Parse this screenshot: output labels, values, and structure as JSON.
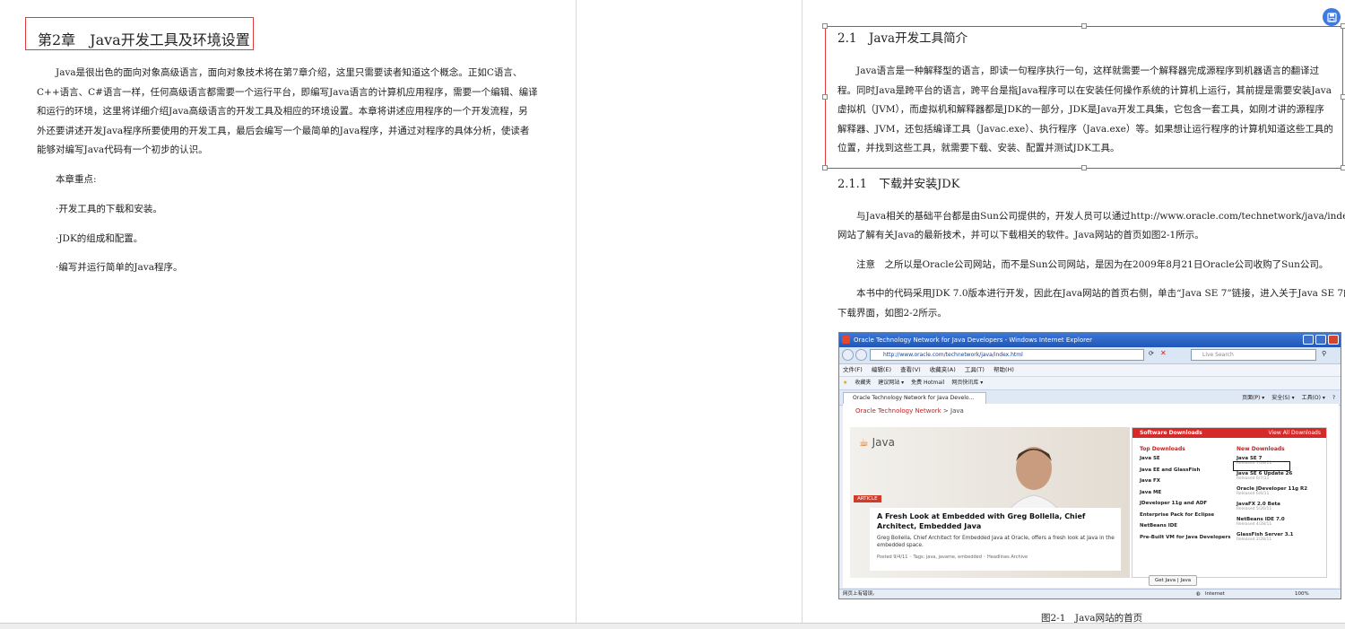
{
  "left": {
    "chapter_title": "第2章　Java开发工具及环境设置",
    "intro_lines": [
      "Java是很出色的面向对象高级语言，面向对象技术将在第7章介绍，这里只需要读者知道这个概念。正如C语言、",
      "C++语言、C#语言一样，任何高级语言都需要一个运行平台，即编写Java语言的计算机应用程序，需要一个编辑、编译",
      "和运行的环境，这里将详细介绍Java高级语言的开发工具及相应的环境设置。本章将讲述应用程序的一个开发流程，另",
      "外还要讲述开发Java程序所要使用的开发工具，最后会编写一个最简单的Java程序，并通过对程序的具体分析，使读者",
      "能够对编写Java代码有一个初步的认识。"
    ],
    "focus_heading": "本章重点:",
    "focus_items": [
      "·开发工具的下载和安装。",
      "·JDK的组成和配置。",
      "·编写并运行简单的Java程序。"
    ]
  },
  "right": {
    "section_title": "2.1　Java开发工具简介",
    "section_lines": [
      "Java语言是一种解释型的语言，即读一句程序执行一句，这样就需要一个解释器完成源程序到机器语言的翻译过",
      "程。同时Java是跨平台的语言，跨平台是指Java程序可以在安装任何操作系统的计算机上运行，其前提是需要安装Java",
      "虚拟机（JVM），而虚拟机和解释器都是JDK的一部分，JDK是Java开发工具集，它包含一套工具，如刚才讲的源程序",
      "解释器、JVM，还包括编译工具（Javac.exe）、执行程序（Java.exe）等。如果想让运行程序的计算机知道这些工具的",
      "位置，并找到这些工具，就需要下载、安装、配置并测试JDK工具。"
    ],
    "subsection_title": "2.1.1　下载并安装JDK",
    "sub_lines": [
      "与Java相关的基础平台都是由Sun公司提供的，开发人员可以通过http://www.oracle.com/technetwork/java/index.html",
      "网站了解有关Java的最新技术，并可以下载相关的软件。Java网站的首页如图2-1所示。"
    ],
    "note_line": "注意　之所以是Oracle公司网站，而不是Sun公司网站，是因为在2009年8月21日Oracle公司收购了Sun公司。",
    "body_lines": [
      "本书中的代码采用JDK 7.0版本进行开发，因此在Java网站的首页右侧，单击“Java SE 7”链接，进入关于Java SE 7的",
      "下载界面，如图2-2所示。"
    ],
    "caption": "图2-1　Java网站的首页"
  },
  "browser": {
    "title": "Oracle Technology Network for Java Developers - Windows Internet Explorer",
    "address": "http://www.oracle.com/technetwork/java/index.html",
    "search": "Live Search",
    "menu": [
      "文件(F)",
      "编辑(E)",
      "查看(V)",
      "收藏夹(A)",
      "工具(T)",
      "帮助(H)"
    ],
    "favorites": [
      "收藏夹",
      "建议网站 ▾",
      "免费 Hotmail",
      "网页快讯库 ▾"
    ],
    "tab_label": "Oracle Technology Network for Java Develo...",
    "commands": [
      "页面(P) ▾",
      "安全(S) ▾",
      "工具(O) ▾"
    ],
    "breadcrumb_home": "Oracle Technology Network",
    "breadcrumb_sep": ">",
    "breadcrumb_current": "Java",
    "java_logo": "Java",
    "article_tag": "ARTICLE",
    "article_title": "A Fresh Look at Embedded with Greg Bollella, Chief Architect, Embedded Java",
    "article_text": "Greg Bollella, Chief Architect for Embedded Java at Oracle, offers a fresh look at Java in the embedded space.",
    "article_meta": "Posted 9/4/11  ◦  Tags: java, javame, embedded  ◦  Headlines Archive",
    "dl_head": "Software Downloads",
    "dl_all": "View All Downloads",
    "top_title": "Top Downloads",
    "top_items": [
      "Java SE",
      "Java EE and GlassFish",
      "Java FX",
      "Java ME",
      "JDeveloper 11g and ADF",
      "Enterprise Pack for Eclipse",
      "NetBeans IDE",
      "Pre-Built VM for Java Developers"
    ],
    "new_title": "New Downloads",
    "new_items": [
      {
        "name": "Java SE 7",
        "date": "Released 7/28/11"
      },
      {
        "name": "Java SE 6 Update 26",
        "date": "Released 6/7/11"
      },
      {
        "name": "Oracle JDeveloper 11g R2",
        "date": "Released 6/6/11"
      },
      {
        "name": "JavaFX 2.0 Beta",
        "date": "Released 5/26/11"
      },
      {
        "name": "NetBeans IDE 7.0",
        "date": "Released 4/28/11"
      },
      {
        "name": "GlassFish Server 3.1",
        "date": "Released 2/28/11"
      }
    ],
    "get_java": "Get Java | Java",
    "status_left": "网页上有错误。",
    "status_zone": "Internet",
    "status_zoom": "100%"
  }
}
